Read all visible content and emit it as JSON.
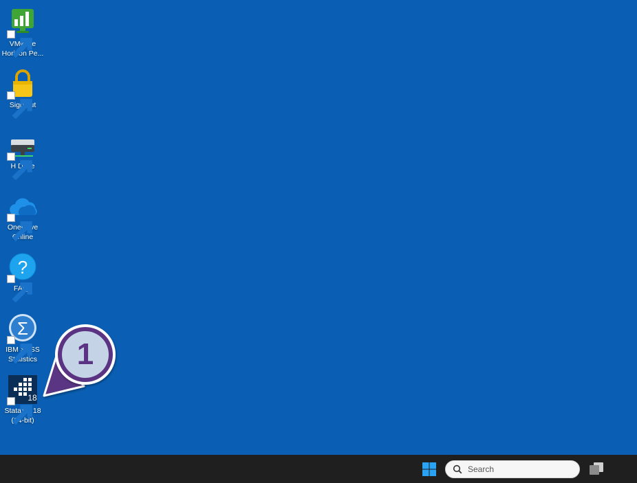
{
  "desktop": {
    "background_color": "#0a5fb4",
    "icons": [
      {
        "label": "VMware\nHorizon Pe...",
        "icon": "vmware-horizon-icon"
      },
      {
        "label": "Sign out",
        "icon": "lock-icon"
      },
      {
        "label": "H Drive",
        "icon": "network-drive-icon"
      },
      {
        "label": "OneDrive\nOnline",
        "icon": "onedrive-cloud-icon"
      },
      {
        "label": "FAQs",
        "icon": "question-mark-icon"
      },
      {
        "label": "IBM SPSS\nStatistics",
        "icon": "spss-sigma-icon"
      },
      {
        "label": "StataSE 18\n(64-bit)",
        "icon": "stata-icon"
      }
    ]
  },
  "callout": {
    "number": "1",
    "color": "#5a3483",
    "fill": "#c5d3e6"
  },
  "taskbar": {
    "background_color": "#1f1f1f",
    "search_placeholder": "Search"
  }
}
